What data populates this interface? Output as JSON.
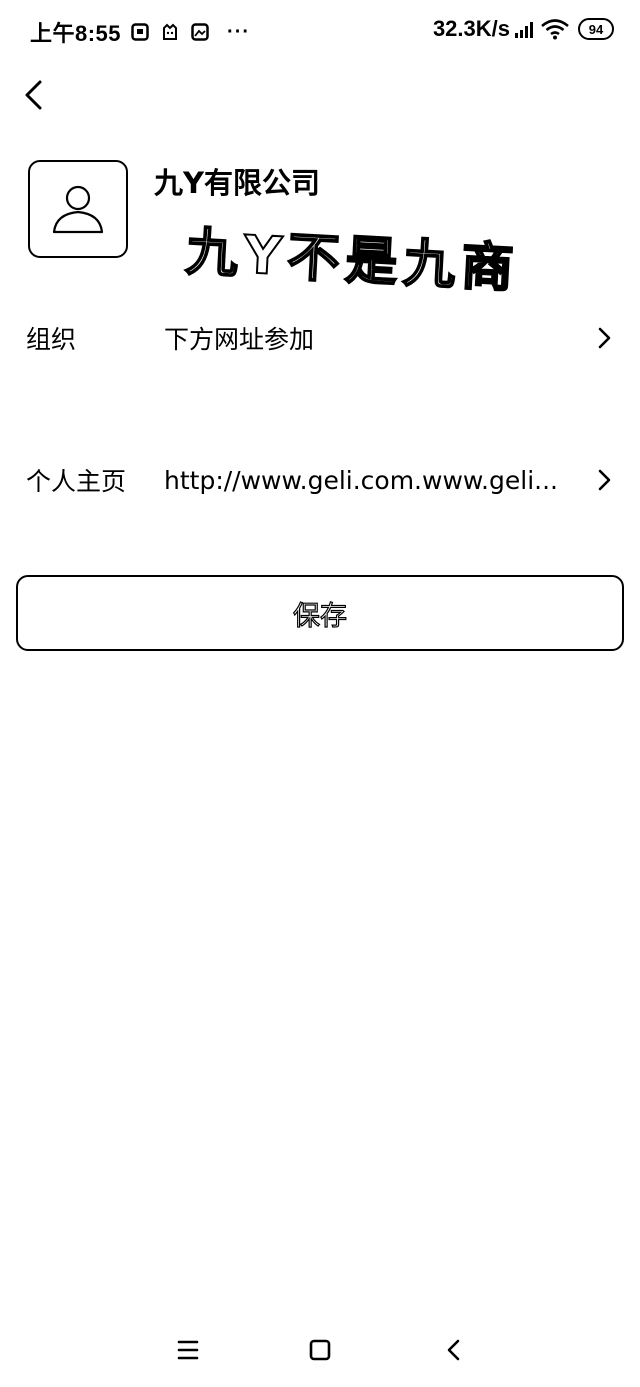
{
  "status_bar": {
    "time": "上午8:55",
    "more": "···",
    "net_speed": "32.3K/s",
    "battery": "94",
    "notification_icons": [
      "app-notification-icon",
      "cat-notification-icon",
      "image-notification-icon"
    ]
  },
  "header": {
    "back_icon": "chevron-left-icon"
  },
  "profile": {
    "avatar_icon": "user-icon",
    "name": "九Y有限公司",
    "watermark": "九Y不是九商"
  },
  "fields": [
    {
      "label": "组织",
      "value": "下方网址参加"
    },
    {
      "label": "个人主页",
      "value": "http://www.geli.com.www.geli..."
    }
  ],
  "actions": {
    "save_label": "保存"
  },
  "nav_bar": {
    "items": [
      "menu-icon",
      "home-square-icon",
      "back-triangle-icon"
    ]
  }
}
